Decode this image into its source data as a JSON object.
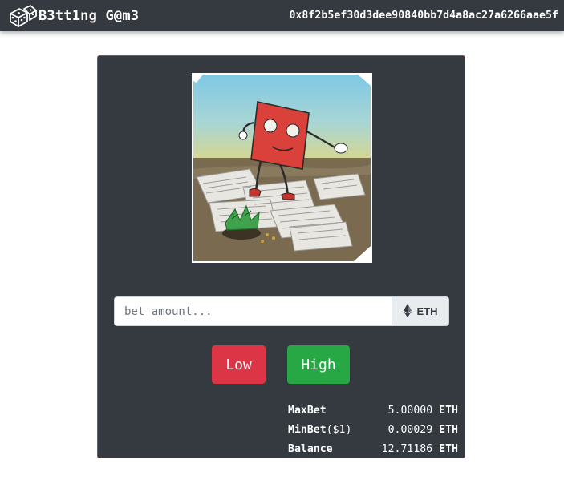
{
  "header": {
    "brand": "B3tt1ng G@m3",
    "address": "0x8f2b5ef30d3dee90840bb7d4a8ac27a6266aae5f"
  },
  "bet": {
    "placeholder": "bet amount...",
    "currency": "ETH",
    "currency_icon": "ethereum-icon"
  },
  "buttons": {
    "low": "Low",
    "high": "High"
  },
  "stats": [
    {
      "label": "MaxBet",
      "label_suffix": "",
      "value": "5.00000",
      "unit": "ETH"
    },
    {
      "label": "MinBet",
      "label_suffix": "($1)",
      "value": "0.00029",
      "unit": "ETH"
    },
    {
      "label": "Balance",
      "label_suffix": "",
      "value": "12.71186",
      "unit": "ETH"
    }
  ],
  "colors": {
    "navbar": "#343a40",
    "card": "#343a40",
    "card_border": "#c0344b",
    "low": "#dc3545",
    "high": "#28a745"
  }
}
